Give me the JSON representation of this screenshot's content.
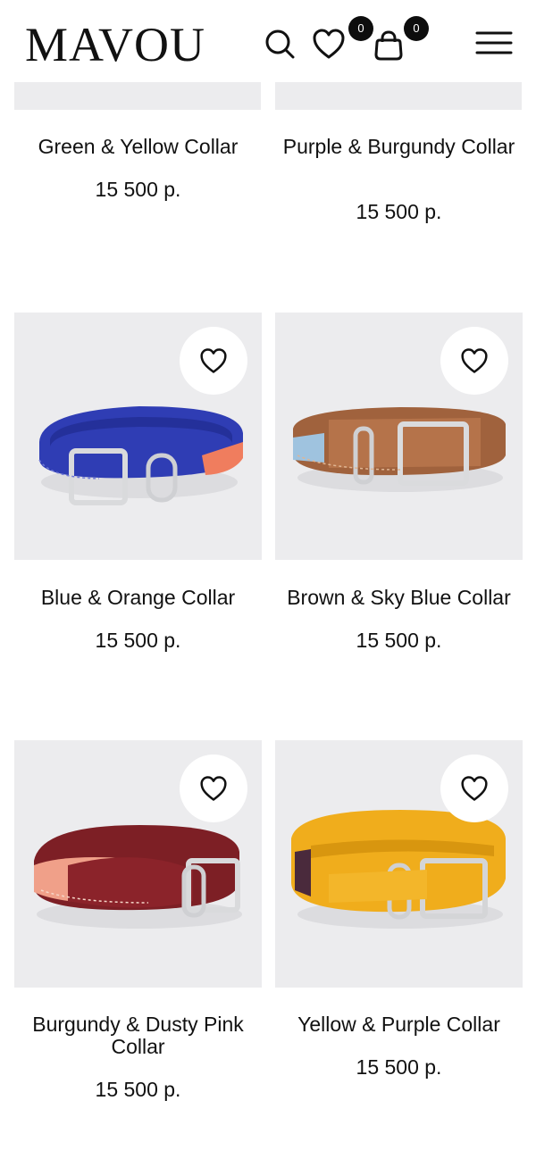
{
  "header": {
    "logo": "MAVOU",
    "favorites_count": "0",
    "cart_count": "0"
  },
  "products": [
    {
      "title": "Green & Yellow Collar",
      "price": "15 500 р.",
      "colors": {
        "main": "#4c7a3c",
        "accent": "#e7c23a"
      }
    },
    {
      "title": "Purple & Burgundy Collar",
      "price": "15 500 р.",
      "colors": {
        "main": "#5a3a6e",
        "accent": "#7b2631"
      }
    },
    {
      "title": "Blue & Orange Collar",
      "price": "15 500 р.",
      "colors": {
        "main": "#2f3db4",
        "accent": "#f07d5e"
      }
    },
    {
      "title": "Brown & Sky Blue Collar",
      "price": "15 500 р.",
      "colors": {
        "main": "#a0623d",
        "accent": "#9fc3df"
      }
    },
    {
      "title": "Burgundy & Dusty Pink Collar",
      "price": "15 500 р.",
      "colors": {
        "main": "#7d1f25",
        "accent": "#f0a089"
      }
    },
    {
      "title": "Yellow & Purple Collar",
      "price": "15 500 р.",
      "colors": {
        "main": "#f0ad1c",
        "accent": "#4a2a3c"
      }
    }
  ],
  "icons": {
    "search": "search-icon",
    "favorites": "heart-icon",
    "cart": "bag-icon",
    "menu": "hamburger-menu-icon",
    "wishlist": "heart-outline-icon"
  }
}
